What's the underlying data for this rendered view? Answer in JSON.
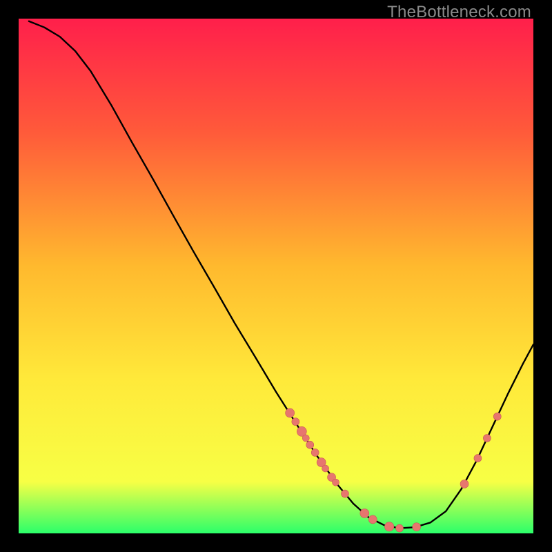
{
  "watermark": "TheBottleneck.com",
  "colors": {
    "bg": "#000000",
    "grad_top": "#ff1f4b",
    "grad_mid1": "#ff5a3a",
    "grad_mid2": "#ffb92e",
    "grad_mid3": "#ffe93a",
    "grad_mid4": "#f7ff45",
    "grad_bottom": "#2bff6a",
    "curve": "#000000",
    "dot_fill": "#e7766e",
    "dot_stroke": "#c95a54"
  },
  "chart_data": {
    "type": "line",
    "title": "",
    "xlabel": "",
    "ylabel": "",
    "xlim": [
      0,
      100
    ],
    "ylim": [
      0,
      100
    ],
    "grid": false,
    "legend": false,
    "curve": [
      {
        "x": 2.0,
        "y": 99.5
      },
      {
        "x": 5.0,
        "y": 98.3
      },
      {
        "x": 8.0,
        "y": 96.5
      },
      {
        "x": 11.0,
        "y": 93.7
      },
      {
        "x": 14.0,
        "y": 89.8
      },
      {
        "x": 18.0,
        "y": 83.2
      },
      {
        "x": 22.0,
        "y": 76.0
      },
      {
        "x": 26.0,
        "y": 69.0
      },
      {
        "x": 30.0,
        "y": 61.8
      },
      {
        "x": 34.0,
        "y": 54.7
      },
      {
        "x": 38.0,
        "y": 47.8
      },
      {
        "x": 42.0,
        "y": 40.8
      },
      {
        "x": 46.0,
        "y": 34.2
      },
      {
        "x": 50.0,
        "y": 27.5
      },
      {
        "x": 54.0,
        "y": 21.2
      },
      {
        "x": 58.0,
        "y": 15.0
      },
      {
        "x": 62.0,
        "y": 9.4
      },
      {
        "x": 65.0,
        "y": 5.8
      },
      {
        "x": 68.0,
        "y": 3.1
      },
      {
        "x": 71.0,
        "y": 1.6
      },
      {
        "x": 74.0,
        "y": 1.0
      },
      {
        "x": 77.0,
        "y": 1.2
      },
      {
        "x": 80.0,
        "y": 2.1
      },
      {
        "x": 83.0,
        "y": 4.3
      },
      {
        "x": 86.0,
        "y": 8.6
      },
      {
        "x": 89.0,
        "y": 14.2
      },
      {
        "x": 92.0,
        "y": 20.6
      },
      {
        "x": 95.0,
        "y": 27.0
      },
      {
        "x": 98.0,
        "y": 33.0
      },
      {
        "x": 100.0,
        "y": 36.7
      }
    ],
    "dots": [
      {
        "x": 52.7,
        "y": 23.4,
        "r": 6.5
      },
      {
        "x": 53.8,
        "y": 21.7,
        "r": 5.5
      },
      {
        "x": 55.0,
        "y": 19.8,
        "r": 7.0
      },
      {
        "x": 55.8,
        "y": 18.5,
        "r": 5.0
      },
      {
        "x": 56.6,
        "y": 17.2,
        "r": 5.5
      },
      {
        "x": 57.6,
        "y": 15.7,
        "r": 5.5
      },
      {
        "x": 58.8,
        "y": 13.8,
        "r": 6.5
      },
      {
        "x": 59.6,
        "y": 12.6,
        "r": 5.0
      },
      {
        "x": 60.8,
        "y": 10.9,
        "r": 6.0
      },
      {
        "x": 61.6,
        "y": 9.9,
        "r": 5.0
      },
      {
        "x": 63.4,
        "y": 7.7,
        "r": 5.5
      },
      {
        "x": 67.2,
        "y": 3.9,
        "r": 6.5
      },
      {
        "x": 68.8,
        "y": 2.7,
        "r": 6.0
      },
      {
        "x": 72.0,
        "y": 1.3,
        "r": 6.7
      },
      {
        "x": 74.0,
        "y": 1.0,
        "r": 5.5
      },
      {
        "x": 77.3,
        "y": 1.25,
        "r": 6.0
      },
      {
        "x": 86.6,
        "y": 9.6,
        "r": 6.0
      },
      {
        "x": 89.2,
        "y": 14.6,
        "r": 5.5
      },
      {
        "x": 91.0,
        "y": 18.5,
        "r": 5.5
      },
      {
        "x": 93.0,
        "y": 22.7,
        "r": 5.5
      }
    ]
  }
}
